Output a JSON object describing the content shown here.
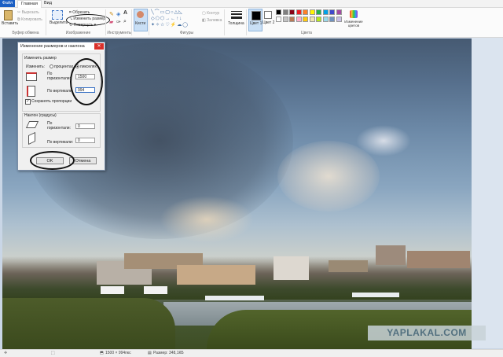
{
  "tabs": [
    {
      "label": "Файл"
    },
    {
      "label": "Главная"
    },
    {
      "label": "Вид"
    }
  ],
  "ribbon": {
    "clipboard": {
      "paste": "Вставить",
      "cut": "Вырезать",
      "copy": "Копировать",
      "group": "Буфер обмена"
    },
    "image": {
      "select": "Выделить",
      "crop": "Обрезать",
      "resize": "Изменить размер",
      "rotate": "Повернуть",
      "group": "Изображение"
    },
    "tools": {
      "group": "Инструменты"
    },
    "brushes": {
      "label": "Кисти"
    },
    "shapes": {
      "outline": "Контур",
      "fill": "Заливка",
      "group": "Фигуры"
    },
    "size": {
      "label": "Толщина"
    },
    "color1": {
      "label": "Цвет 1"
    },
    "color2": {
      "label": "Цвет 2"
    },
    "colors": {
      "edit": "Изменение цветов",
      "group": "Цвета"
    }
  },
  "palette": [
    "#000000",
    "#7f7f7f",
    "#880015",
    "#ed1c24",
    "#ff7f27",
    "#fff200",
    "#22b14c",
    "#00a2e8",
    "#3f48cc",
    "#a349a4",
    "#ffffff",
    "#c3c3c3",
    "#b97a57",
    "#ffaec9",
    "#ffc90e",
    "#efe4b0",
    "#b5e61d",
    "#99d9ea",
    "#7092be",
    "#c8bfe7"
  ],
  "dialog": {
    "title": "Изменение размеров и наклона",
    "resize_section": "Изменить размер",
    "by_label": "Изменить:",
    "percent": "процентах",
    "pixels": "пикселях",
    "horizontal_label": "По горизонтали:",
    "horizontal_value": "1500",
    "vertical_label": "По вертикали:",
    "vertical_value": "994",
    "keep_ratio": "Сохранять пропорции",
    "skew_section": "Наклон (градусы)",
    "skew_h_label": "По горизонтали:",
    "skew_h_value": "0",
    "skew_v_label": "По вертикали:",
    "skew_v_value": "0",
    "ok": "OK",
    "cancel": "Отмена"
  },
  "status": {
    "dimensions": "1500 × 994пкс",
    "size": "Размер: 348,1КБ"
  },
  "watermark": "YAPLAKAL.COM"
}
